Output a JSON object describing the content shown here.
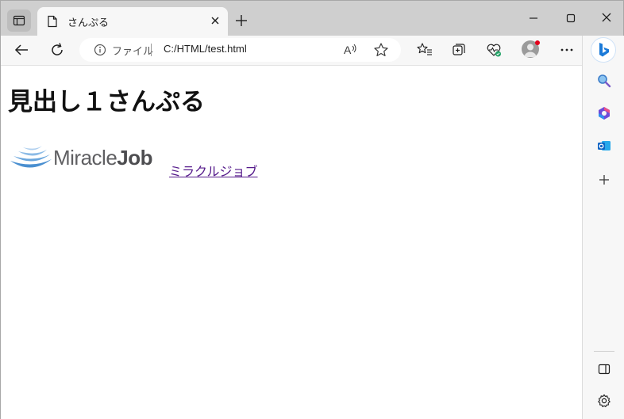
{
  "tab": {
    "title": "さんぷる"
  },
  "address_bar": {
    "label": "ファイル",
    "url": "C:/HTML/test.html"
  },
  "page": {
    "heading": "見出し１さんぷる",
    "logo": {
      "text_light": "Miracle",
      "text_bold": "Job"
    },
    "link_text": "ミラクルジョブ"
  },
  "colors": {
    "titlebar": "#cfcfcf",
    "toolbar": "#f7f7f7",
    "link_visited": "#551a8b",
    "logo_blue": "#4a8fd0",
    "notification_dot": "#e3001b"
  }
}
